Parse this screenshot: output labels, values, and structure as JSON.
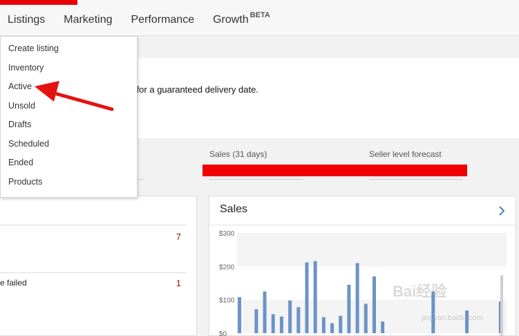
{
  "nav": {
    "tabs": [
      "Listings",
      "Marketing",
      "Performance",
      "Growth"
    ],
    "growth_badge": "BETA"
  },
  "menu": {
    "items": [
      "Create listing",
      "Inventory",
      "Active",
      "Unsold",
      "Drafts",
      "Scheduled",
      "Ended",
      "Products"
    ]
  },
  "banner": {
    "text": "ook for a guaranteed delivery date."
  },
  "stats": {
    "sales_label": "Sales (31 days)",
    "seller_level_label": "Seller level forecast"
  },
  "tasks": {
    "row1_count": "7",
    "row2_text": "e failed",
    "row2_count": "1"
  },
  "sales_card": {
    "title": "Sales"
  },
  "chart_data": {
    "type": "bar",
    "title": "Sales",
    "ylim": [
      0,
      300
    ],
    "yticks": [
      "$300",
      "$200",
      "$100",
      "$0"
    ],
    "values": [
      108,
      0,
      72,
      125,
      57,
      50,
      98,
      78,
      212,
      216,
      48,
      30,
      52,
      145,
      210,
      88,
      170,
      35,
      0,
      0,
      0,
      0,
      0,
      125,
      0,
      0,
      0,
      68,
      0,
      0,
      0,
      95
    ],
    "bar_color": "#6b93c7"
  },
  "watermark": {
    "main": "Bai经验",
    "sub": "jingyan.baidu.com"
  },
  "colors": {
    "accent_red": "#e60000",
    "count_red": "#a01010"
  }
}
